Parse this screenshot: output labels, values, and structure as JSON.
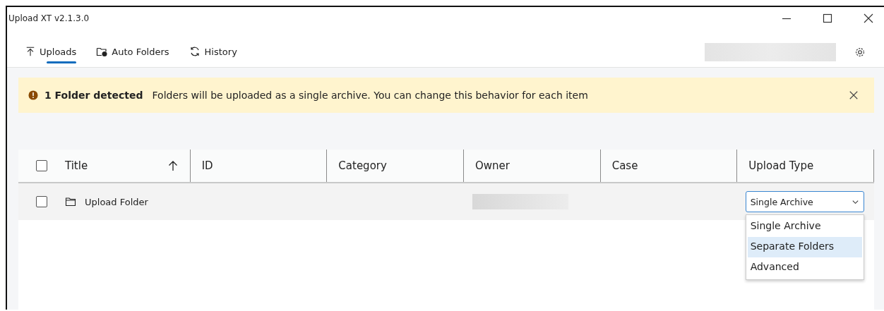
{
  "window": {
    "title": "Upload XT v2.1.3.0"
  },
  "tabs": [
    {
      "label": "Uploads",
      "kind": "upload",
      "selected": true
    },
    {
      "label": "Auto Folders",
      "kind": "autofolder",
      "selected": false
    },
    {
      "label": "History",
      "kind": "history",
      "selected": false
    }
  ],
  "banner": {
    "title": "1 Folder detected",
    "message": "Folders will be uploaded as a single archive. You can change this behavior for each item"
  },
  "table": {
    "select_all": {
      "checked": false
    },
    "columns": [
      {
        "label": "Title",
        "sorted": true
      },
      {
        "label": "ID",
        "sorted": false
      },
      {
        "label": "Category",
        "sorted": false
      },
      {
        "label": "Owner",
        "sorted": false
      },
      {
        "label": "Case",
        "sorted": false
      },
      {
        "label": "Upload Type",
        "sorted": false
      }
    ],
    "rows": [
      {
        "checked": false,
        "title": "Upload Folder",
        "upload_type": "Single Archive"
      }
    ]
  },
  "dropdown": {
    "options": [
      {
        "label": "Single Archive",
        "selected": false
      },
      {
        "label": "Separate Folders",
        "selected": true
      },
      {
        "label": "Advanced",
        "selected": false
      }
    ]
  }
}
